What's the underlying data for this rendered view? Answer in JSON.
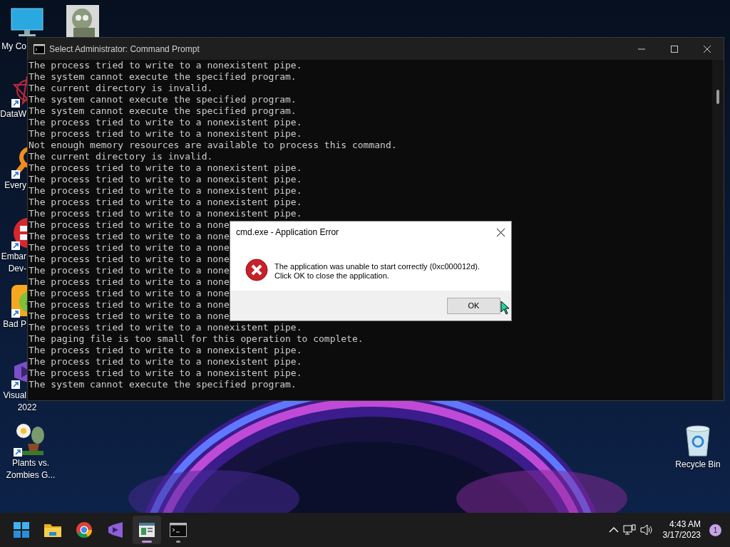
{
  "desktop_icons": [
    {
      "kind": "computer",
      "label_lines": [
        "My Co"
      ]
    },
    {
      "kind": "zombie"
    },
    {
      "kind": "star",
      "label_lines": [
        "DataW"
      ],
      "shortcut": true
    },
    {
      "kind": "search-app",
      "label_lines": [
        "Every"
      ],
      "shortcut": true
    },
    {
      "kind": "red-app",
      "label_lines": [
        "Embar",
        "Dev-"
      ],
      "shortcut": true
    },
    {
      "kind": "pig",
      "label_lines": [
        "Bad P"
      ],
      "shortcut": true
    },
    {
      "kind": "studio",
      "label_lines": [
        "Visual",
        "2022"
      ],
      "shortcut": true
    },
    {
      "kind": "flower",
      "label_lines": [
        "Plants vs.",
        "Zombies G..."
      ],
      "shortcut": true
    },
    {
      "kind": "recycle",
      "label_lines": [
        "Recycle Bin"
      ]
    }
  ],
  "cmd_window": {
    "title": "Select Administrator:  Command Prompt",
    "lines": [
      "The process tried to write to a nonexistent pipe.",
      "The system cannot execute the specified program.",
      "The current directory is invalid.",
      "The system cannot execute the specified program.",
      "The system cannot execute the specified program.",
      "The process tried to write to a nonexistent pipe.",
      "The process tried to write to a nonexistent pipe.",
      "Not enough memory resources are available to process this command.",
      "The current directory is invalid.",
      "The process tried to write to a nonexistent pipe.",
      "The process tried to write to a nonexistent pipe.",
      "The process tried to write to a nonexistent pipe.",
      "The process tried to write to a nonexistent pipe.",
      "The process tried to write to a nonexistent pipe.",
      "The process tried to write to a none",
      "The process tried to write to a none",
      "The process tried to write to a none",
      "The process tried to write to a none",
      "The process tried to write to a none",
      "The process tried to write to a none",
      "The process tried to write to a none",
      "The process tried to write to a none",
      "The process tried to write to a none",
      "The process tried to write to a nonexistent pipe.",
      "The paging file is too small for this operation to complete.",
      "The process tried to write to a nonexistent pipe.",
      "The process tried to write to a nonexistent pipe.",
      "The process tried to write to a nonexistent pipe.",
      "The system cannot execute the specified program."
    ]
  },
  "error_dialog": {
    "title": "cmd.exe - Application Error",
    "message_lines": [
      "The application was unable to start correctly (0xc000012d).",
      "Click OK to close the application."
    ],
    "button": "OK"
  },
  "taskbar": {
    "apps": [
      {
        "kind": "start",
        "active": false,
        "running": false
      },
      {
        "kind": "folder",
        "active": false,
        "running": false
      },
      {
        "kind": "browser",
        "active": false,
        "running": false
      },
      {
        "kind": "studio",
        "active": false,
        "running": false
      },
      {
        "kind": "window",
        "active": true,
        "running": true
      },
      {
        "kind": "terminal",
        "active": false,
        "running": true
      }
    ],
    "time": "4:43 AM",
    "date": "3/17/2023",
    "notification_count": "1"
  }
}
